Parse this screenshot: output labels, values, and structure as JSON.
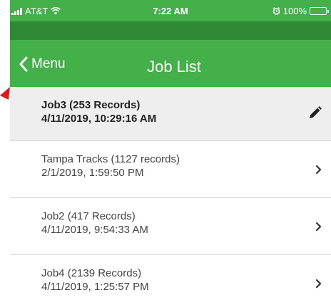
{
  "status": {
    "carrier": "AT&T",
    "time": "7:22 AM",
    "battery": "100%",
    "battery_level": 1.0
  },
  "nav": {
    "back_label": "Menu",
    "title": "Job List"
  },
  "jobs": [
    {
      "name": "Job3 (253 Records)",
      "date": "4/11/2019, 10:29:16 AM",
      "action": "edit-icon"
    },
    {
      "name": "Tampa Tracks (1127 records)",
      "date": "2/1/2019, 1:59:50 PM",
      "action": "chevron-right-icon"
    },
    {
      "name": "Job2 (417 Records)",
      "date": "4/11/2019, 9:54:33 AM",
      "action": "chevron-right-icon"
    },
    {
      "name": "Job4 (2139 Records)",
      "date": "4/11/2019, 1:25:57 PM",
      "action": "chevron-right-icon"
    }
  ],
  "colors": {
    "nav_green": "#43b04a",
    "dark_green": "#2f8a36",
    "selected_bg": "#eeeeee",
    "annotation_red": "#e8141b"
  }
}
